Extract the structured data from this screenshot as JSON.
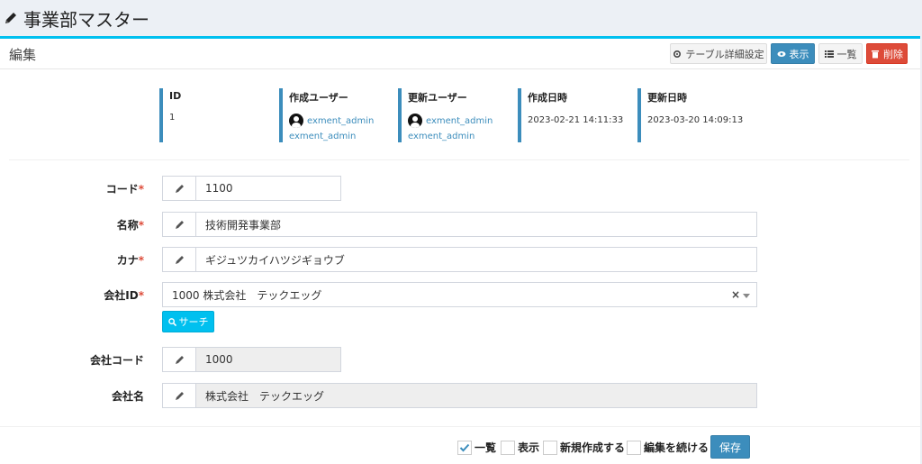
{
  "page": {
    "title": "事業部マスター"
  },
  "box": {
    "title": "編集",
    "buttons": {
      "table_settings": "テーブル詳細設定",
      "view": "表示",
      "list": "一覧",
      "delete": "削除"
    }
  },
  "meta": [
    {
      "label": "ID",
      "value": "1"
    },
    {
      "label": "作成ユーザー",
      "user": "exment_admin",
      "sub": "exment_admin"
    },
    {
      "label": "更新ユーザー",
      "user": "exment_admin",
      "sub": "exment_admin"
    },
    {
      "label": "作成日時",
      "value": "2023-02-21 14:11:33"
    },
    {
      "label": "更新日時",
      "value": "2023-03-20 14:09:13"
    }
  ],
  "form": {
    "code": {
      "label": "コード",
      "value": "1100"
    },
    "name": {
      "label": "名称",
      "value": "技術開発事業部"
    },
    "kana": {
      "label": "カナ",
      "value": "ギジュツカイハツジギョウブ"
    },
    "company_id": {
      "label": "会社ID",
      "value": "1000 株式会社　テックエッグ",
      "clear": "×"
    },
    "search_button": "サーチ",
    "company_code": {
      "label": "会社コード",
      "value": "1000"
    },
    "company_name": {
      "label": "会社名",
      "value": "株式会社　テックエッグ"
    },
    "required_mark": "*"
  },
  "footer": {
    "checks": [
      {
        "label": "一覧",
        "checked": true
      },
      {
        "label": "表示",
        "checked": false
      },
      {
        "label": "新規作成する",
        "checked": false
      },
      {
        "label": "編集を続ける",
        "checked": false
      }
    ],
    "save": "保存"
  },
  "colors": {
    "primary": "#3c8dbc",
    "info": "#00c0ef",
    "danger": "#dd4b39"
  }
}
